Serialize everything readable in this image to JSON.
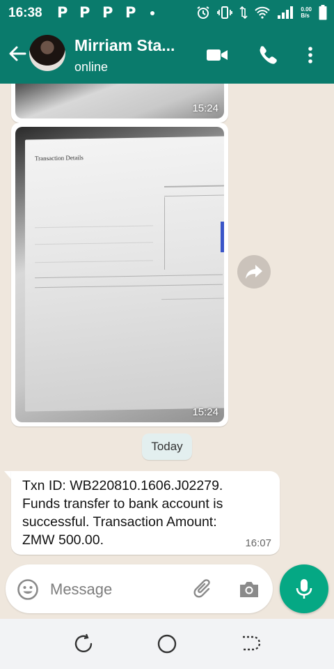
{
  "status_bar": {
    "time": "16:38",
    "notif_letters": [
      "P",
      "P",
      "P",
      "P"
    ],
    "net_speed_value": "0.00",
    "net_speed_unit": "B/s",
    "icons": [
      "alarm-icon",
      "vibrate-icon",
      "data-arrows-icon",
      "wifi-icon",
      "signal-icon",
      "battery-icon"
    ]
  },
  "header": {
    "contact_name": "Mirriam Sta...",
    "status": "online",
    "actions": [
      "back-arrow-icon",
      "video-call-icon",
      "voice-call-icon",
      "more-vert-icon"
    ]
  },
  "messages": [
    {
      "type": "image",
      "time": "15:24",
      "partial": true
    },
    {
      "type": "image",
      "time": "15:24",
      "doc_title": "Transaction Details"
    },
    {
      "type": "date_chip",
      "label": "Today"
    },
    {
      "type": "text",
      "text": "Txn ID: WB220810.1606.J02279. Funds transfer to bank account is successful. Transaction Amount: ZMW 500.00.",
      "time": "16:07"
    }
  ],
  "composer": {
    "placeholder": "Message",
    "icons": [
      "emoji-icon",
      "attach-icon",
      "camera-icon",
      "mic-icon"
    ]
  },
  "colors": {
    "header": "#0a7b6c",
    "accent": "#05a884",
    "chat_bg": "#efe7dd",
    "bubble": "#ffffff"
  }
}
